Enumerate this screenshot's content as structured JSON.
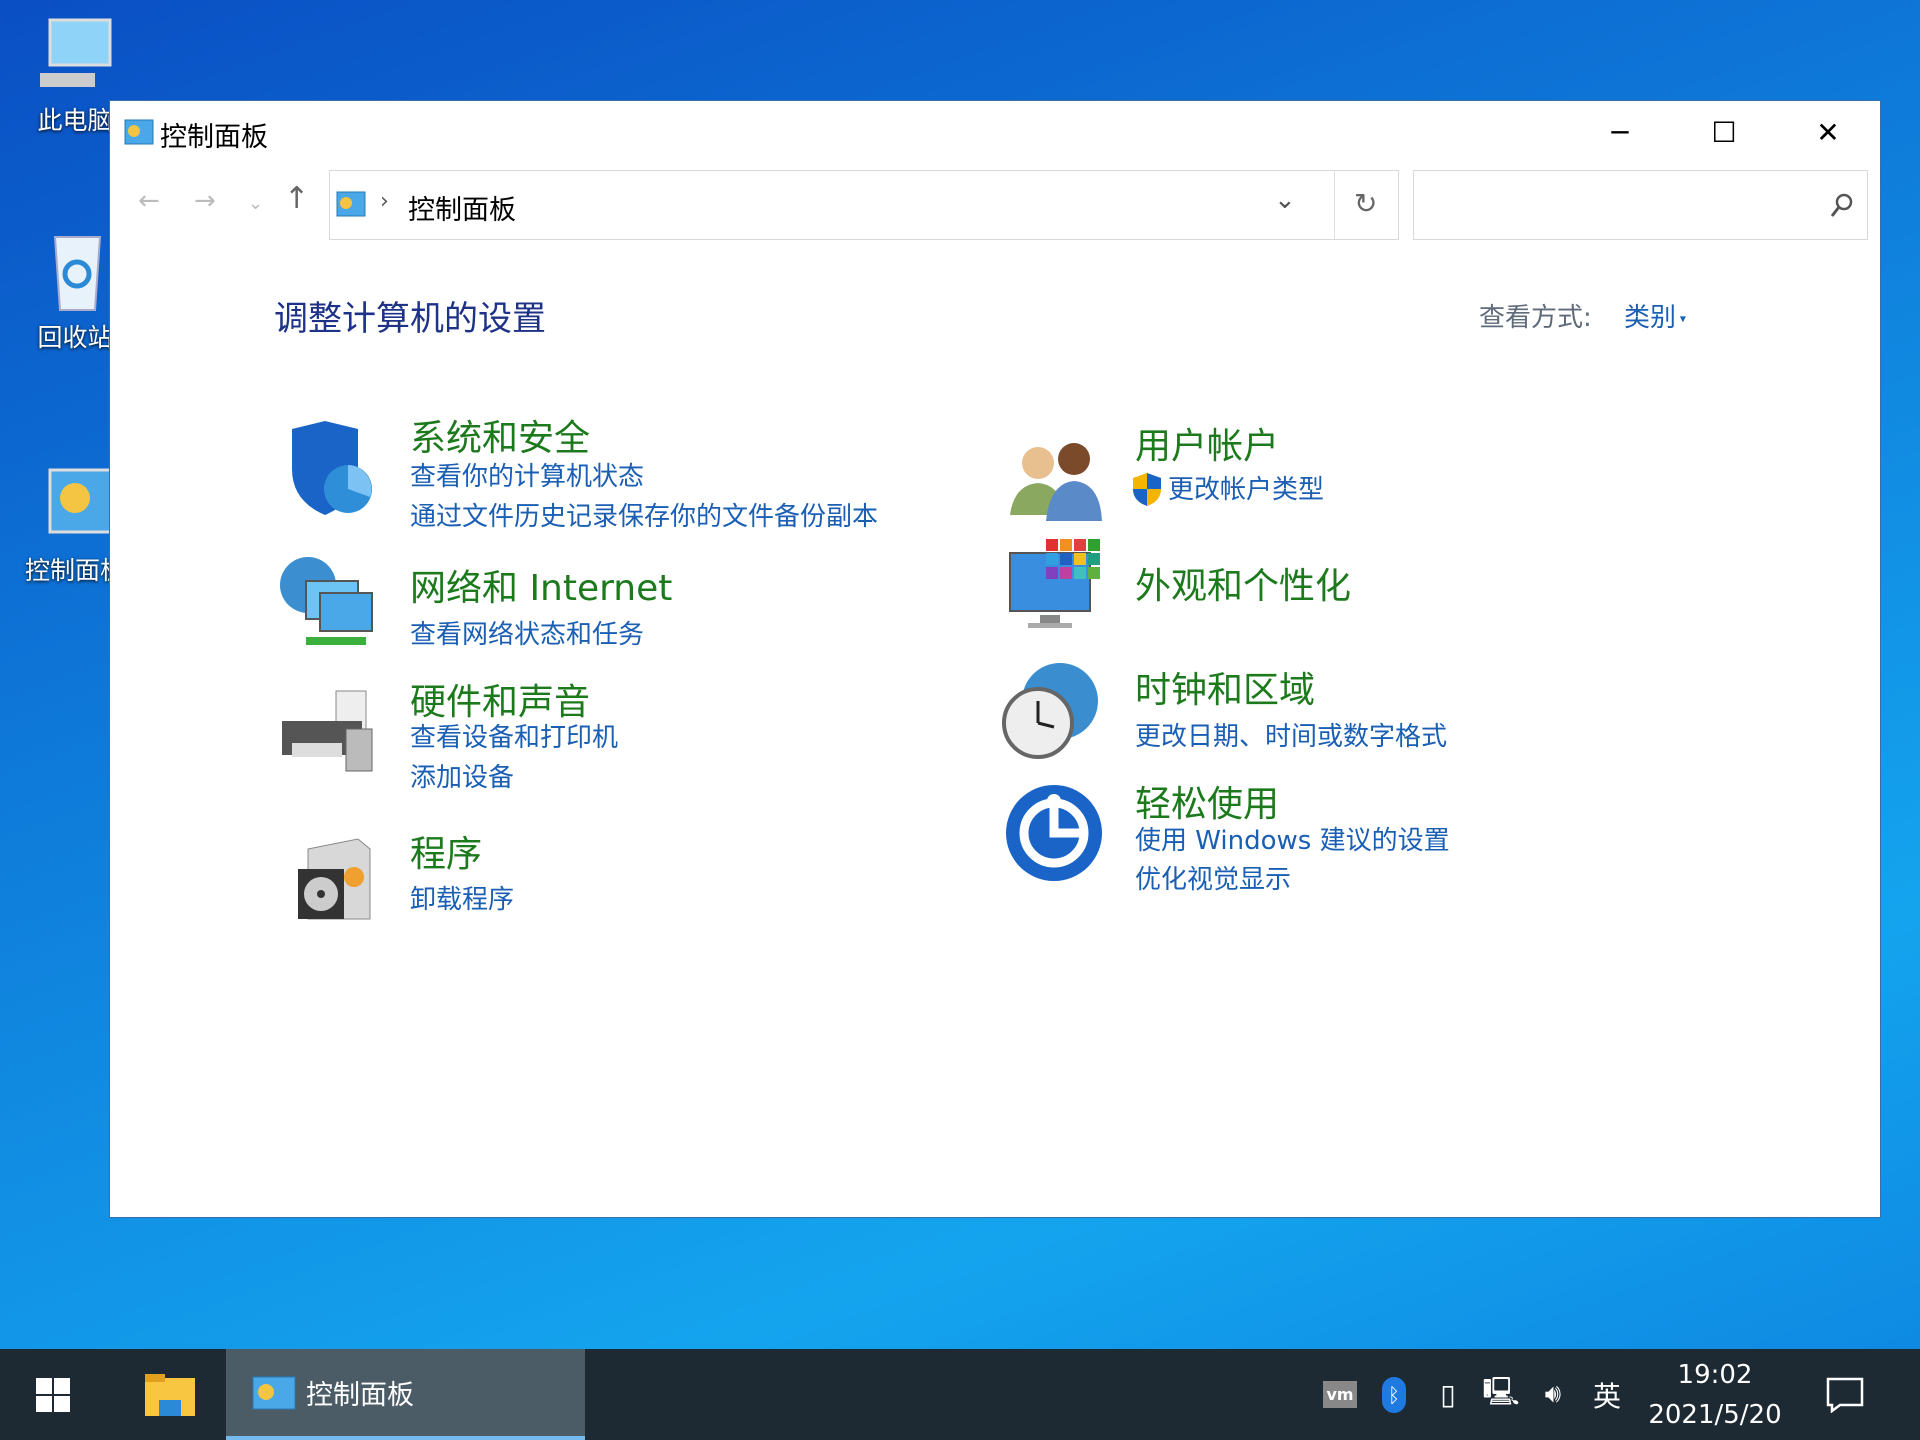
{
  "desktop": {
    "icons": [
      {
        "label": "此电脑",
        "icon": "computer-icon"
      },
      {
        "label": "回收站",
        "icon": "recycle-bin-icon"
      },
      {
        "label": "控制面板",
        "icon": "control-panel-icon"
      }
    ]
  },
  "window": {
    "title": "控制面板",
    "controls": {
      "minimize": "─",
      "maximize": "☐",
      "close": "✕"
    },
    "address": {
      "path": "控制面板",
      "refresh": "↻"
    },
    "search": {
      "value": "",
      "placeholder": ""
    },
    "heading": "调整计算机的设置",
    "view_by_label": "查看方式:",
    "view_by_value": "类别",
    "categories_left": [
      {
        "title": "系统和安全",
        "links": [
          "查看你的计算机状态",
          "通过文件历史记录保存你的文件备份副本"
        ],
        "icon": "shield-icon"
      },
      {
        "title": "网络和 Internet",
        "links": [
          "查看网络状态和任务"
        ],
        "icon": "network-icon"
      },
      {
        "title": "硬件和声音",
        "links": [
          "查看设备和打印机",
          "添加设备"
        ],
        "icon": "printer-icon"
      },
      {
        "title": "程序",
        "links": [
          "卸载程序"
        ],
        "icon": "programs-icon"
      }
    ],
    "categories_right": [
      {
        "title": "用户帐户",
        "links": [
          "更改帐户类型"
        ],
        "icon": "users-icon"
      },
      {
        "title": "外观和个性化",
        "links": [],
        "icon": "appearance-icon"
      },
      {
        "title": "时钟和区域",
        "links": [
          "更改日期、时间或数字格式"
        ],
        "icon": "clock-icon"
      },
      {
        "title": "轻松使用",
        "links": [
          "使用 Windows 建议的设置",
          "优化视觉显示"
        ],
        "icon": "ease-of-access-icon"
      }
    ]
  },
  "taskbar": {
    "active_app": "控制面板",
    "ime": "英",
    "time": "19:02",
    "date": "2021/5/20",
    "accent": "#76b9ed"
  }
}
